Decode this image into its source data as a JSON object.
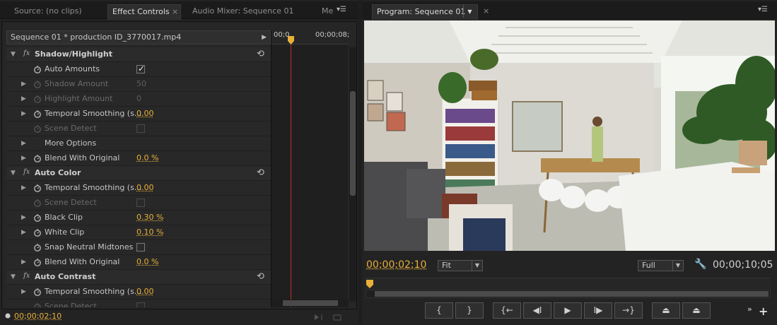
{
  "left_tabs": [
    {
      "label": "Source: (no clips)"
    },
    {
      "label": "Effect Controls"
    },
    {
      "label": "Audio Mixer: Sequence 01"
    },
    {
      "label": "Me"
    }
  ],
  "effect_controls": {
    "sequence_clip": "Sequence 01 * production ID_3770017.mp4",
    "ruler_start": "00;0",
    "ruler_end": "00;00;08;",
    "rows": [
      {
        "type": "group",
        "name": "Shadow/Highlight"
      },
      {
        "type": "param",
        "name": "Auto Amounts",
        "check": true
      },
      {
        "type": "param",
        "name": "Shadow Amount",
        "value": "50",
        "dim": true
      },
      {
        "type": "param",
        "name": "Highlight Amount",
        "value": "0",
        "dim": true
      },
      {
        "type": "param",
        "name": "Temporal Smoothing (s...",
        "value": "0.00"
      },
      {
        "type": "param",
        "name": "Scene Detect",
        "check": false,
        "dim": true
      },
      {
        "type": "param",
        "name": "More Options"
      },
      {
        "type": "param",
        "name": "Blend With Original",
        "value": "0.0 %"
      },
      {
        "type": "group",
        "name": "Auto Color"
      },
      {
        "type": "param",
        "name": "Temporal Smoothing (s...",
        "value": "0.00"
      },
      {
        "type": "param",
        "name": "Scene Detect",
        "check": false,
        "dim": true
      },
      {
        "type": "param",
        "name": "Black Clip",
        "value": "0.30 %"
      },
      {
        "type": "param",
        "name": "White Clip",
        "value": "0.10 %"
      },
      {
        "type": "param",
        "name": "Snap Neutral Midtones",
        "check": false
      },
      {
        "type": "param",
        "name": "Blend With Original",
        "value": "0.0 %"
      },
      {
        "type": "group",
        "name": "Auto Contrast"
      },
      {
        "type": "param",
        "name": "Temporal Smoothing (s...",
        "value": "0.00"
      },
      {
        "type": "param",
        "name": "Scene Detect",
        "check": false,
        "dim": true
      }
    ],
    "timecode": "00;00;02;10"
  },
  "program_monitor": {
    "tab_label": "Program: Sequence 01",
    "current_timecode": "00;00;02;10",
    "zoom": "Fit",
    "resolution": "Full",
    "duration_timecode": "00;00;10;05"
  },
  "icons": {
    "fx": "fx",
    "reset": "reset-icon",
    "stopwatch": "stopwatch-icon"
  },
  "colors": {
    "accent": "#e8b038",
    "playhead": "#c02a2a"
  }
}
